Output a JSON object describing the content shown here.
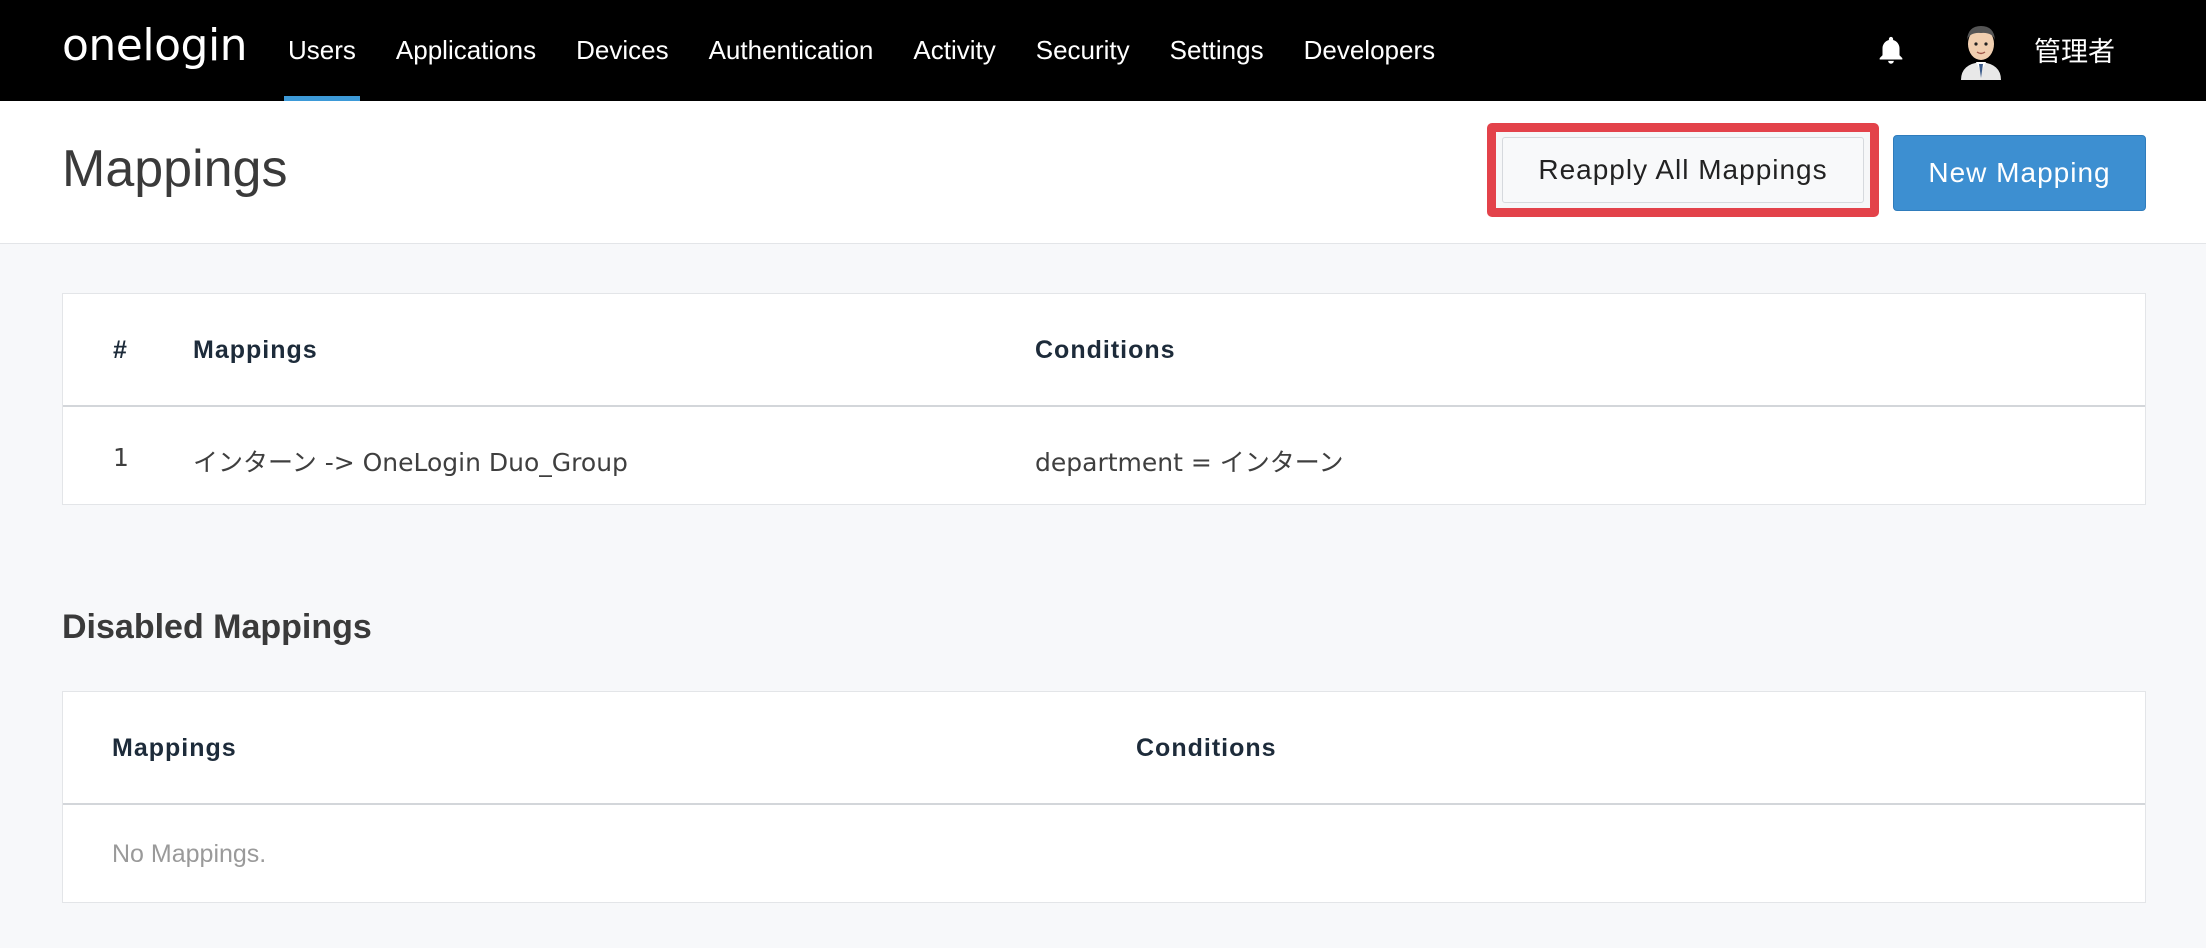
{
  "nav": {
    "logo": "onelogin",
    "items": [
      {
        "label": "Users",
        "active": true
      },
      {
        "label": "Applications"
      },
      {
        "label": "Devices"
      },
      {
        "label": "Authentication"
      },
      {
        "label": "Activity"
      },
      {
        "label": "Security"
      },
      {
        "label": "Settings"
      },
      {
        "label": "Developers"
      }
    ],
    "user_name": "管理者",
    "accent_color": "#3d9ad8"
  },
  "header": {
    "title": "Mappings",
    "reapply_label": "Reapply All Mappings",
    "new_label": "New Mapping",
    "highlight_color": "#e3424a",
    "primary_color": "#3d8fd1"
  },
  "mappings_table": {
    "columns": [
      "#",
      "Mappings",
      "Conditions"
    ],
    "rows": [
      {
        "index": "1",
        "mapping": "インターン -> OneLogin Duo_Group",
        "condition": "department = インターン"
      }
    ]
  },
  "disabled": {
    "title": "Disabled Mappings",
    "columns": [
      "Mappings",
      "Conditions"
    ],
    "empty_text": "No Mappings."
  }
}
